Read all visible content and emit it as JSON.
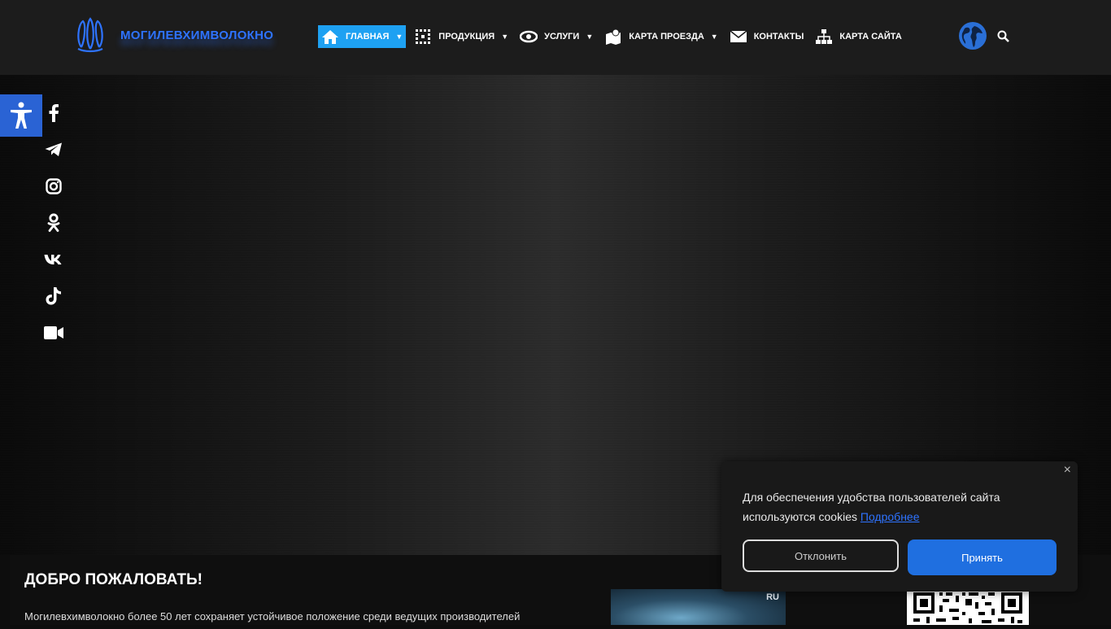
{
  "header": {
    "logo_text": "МОГИЛЕВХИМВОЛОКНО",
    "nav": [
      {
        "label": "ГЛАВНАЯ",
        "icon": "home-icon",
        "caret": true,
        "active": true
      },
      {
        "label": "ПРОДУКЦИЯ",
        "icon": "grid-icon",
        "caret": true
      },
      {
        "label": "УСЛУГИ",
        "icon": "service-icon",
        "caret": true
      },
      {
        "label": "КАРТА ПРОЕЗДА",
        "icon": "map-icon",
        "caret": true
      },
      {
        "label": "КОНТАКТЫ",
        "icon": "mail-icon",
        "caret": false
      },
      {
        "label": "КАРТА САЙТА",
        "icon": "sitemap-icon",
        "caret": false
      }
    ]
  },
  "social": [
    "facebook-icon",
    "telegram-icon",
    "instagram-icon",
    "odnoklassniki-icon",
    "vk-icon",
    "tiktok-icon",
    "video-icon"
  ],
  "welcome": {
    "title": "ДОБРО ПОЖАЛОВАТЬ!",
    "text": "Могилевхимволокно более 50 лет сохраняет устойчивое положение среди ведущих производителей",
    "thumb_label": "RU"
  },
  "cookie": {
    "message": "Для обеспечения удобства пользователей сайта используются cookies",
    "more_link": "Подробнее",
    "decline": "Отклонить",
    "accept": "Принять",
    "close": "×"
  },
  "colors": {
    "accent": "#1ea1f2",
    "brand": "#2e73ff",
    "accessibility": "#2a63d4"
  }
}
